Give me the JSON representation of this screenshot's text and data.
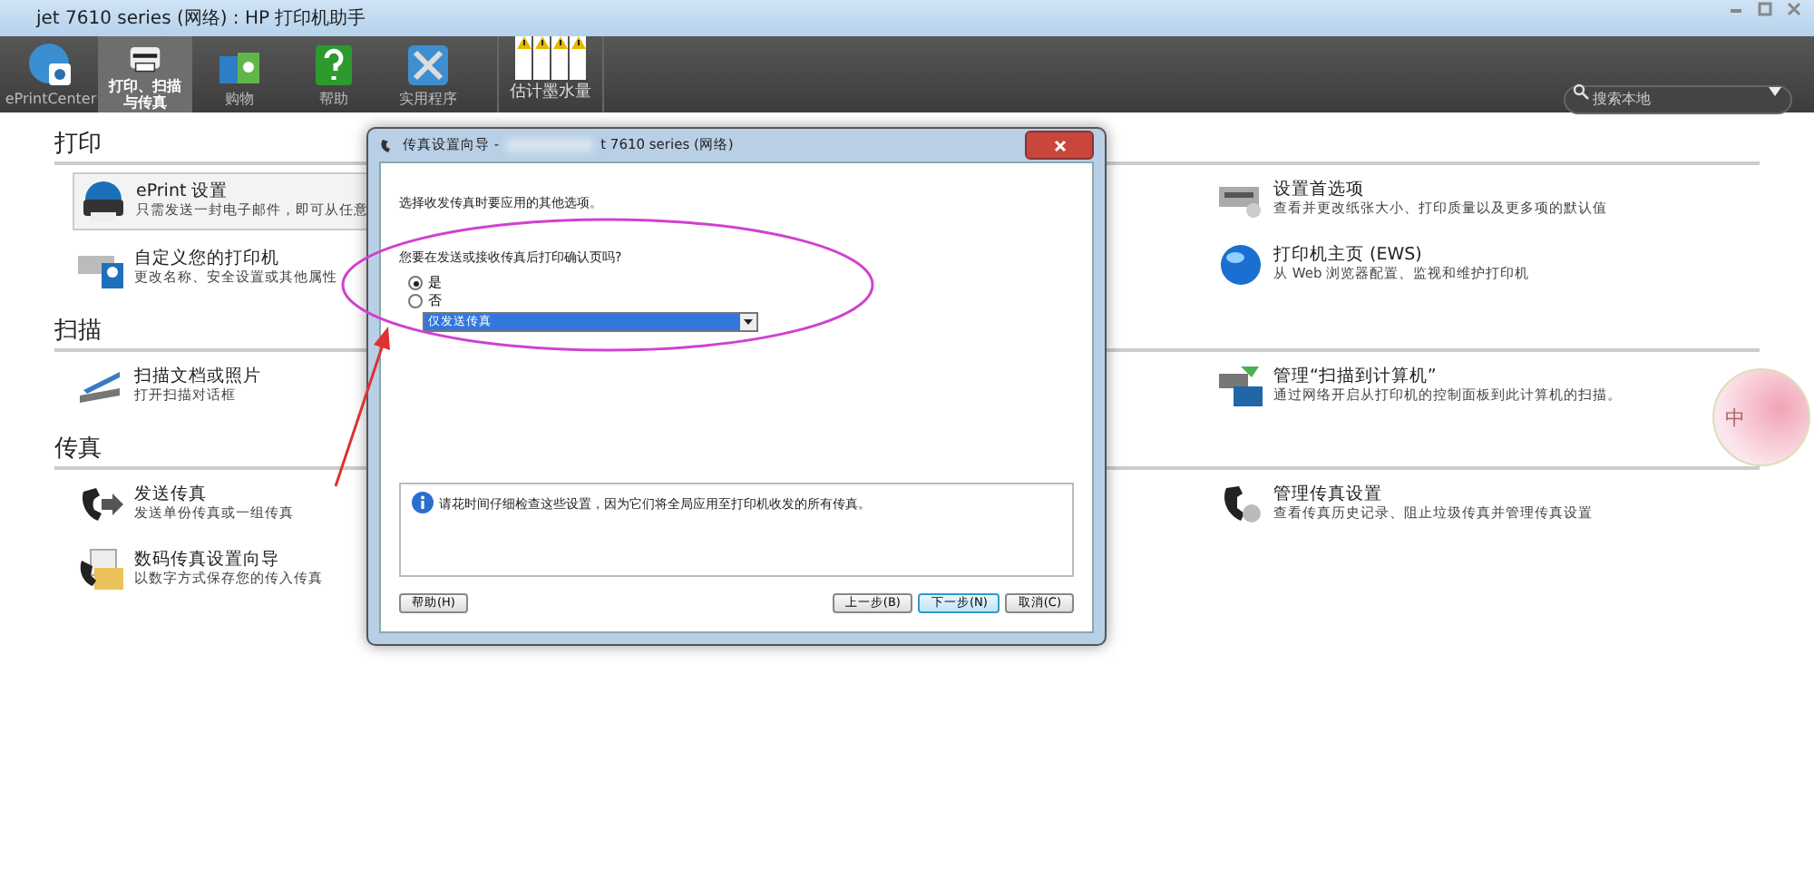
{
  "window": {
    "title": "jet 7610 series (网络) : HP 打印机助手"
  },
  "toolbar": [
    {
      "kind": "eprint",
      "label": "ePrintCenter",
      "selected": false
    },
    {
      "kind": "printer",
      "label": "打印、扫描与传真",
      "selected": true
    },
    {
      "kind": "shop",
      "label": "购物",
      "selected": false
    },
    {
      "kind": "help",
      "label": "帮助",
      "selected": false
    },
    {
      "kind": "tools",
      "label": "实用程序",
      "selected": false
    }
  ],
  "ink": {
    "label": "估计墨水量",
    "cartridges": [
      {
        "warning": true
      },
      {
        "warning": true
      },
      {
        "warning": true
      },
      {
        "warning": true
      }
    ]
  },
  "search": {
    "placeholder": "搜索本地"
  },
  "sections": [
    {
      "title": "打印",
      "left": [
        {
          "kind": "eprint",
          "title": "ePrint 设置",
          "desc": "只需发送一封电子邮件，即可从任意",
          "selected": true
        },
        {
          "kind": "printer",
          "title": "自定义您的打印机",
          "desc": "更改名称、安全设置或其他属性",
          "selected": false
        }
      ],
      "right": [
        {
          "kind": "prefs",
          "title": "设置首选项",
          "desc": "查看并更改纸张大小、打印质量以及更多项的默认值",
          "selected": false
        },
        {
          "kind": "globe",
          "title": "打印机主页 (EWS)",
          "desc": "从 Web 浏览器配置、监视和维护打印机",
          "selected": false
        }
      ]
    },
    {
      "title": "扫描",
      "left": [
        {
          "kind": "scanner",
          "title": "扫描文档或照片",
          "desc": "打开扫描对话框",
          "selected": false
        }
      ],
      "right": [
        {
          "kind": "computer",
          "title": "管理“扫描到计算机”",
          "desc": "通过网络开启从打印机的控制面板到此计算机的扫描。",
          "selected": false
        }
      ]
    },
    {
      "title": "传真",
      "left": [
        {
          "kind": "fax",
          "title": "发送传真",
          "desc": "发送单份传真或一组传真",
          "selected": false
        },
        {
          "kind": "folder",
          "title": "数码传真设置向导",
          "desc": "以数字方式保存您的传入传真",
          "selected": false
        }
      ],
      "right": [
        {
          "kind": "faxgear",
          "title": "管理传真设置",
          "desc": "查看传真历史记录、阻止垃圾传真并管理传真设置",
          "selected": false
        }
      ]
    }
  ],
  "dialog": {
    "title": "传真设置向导 -",
    "title_tail": "t 7610 series (网络)",
    "intro": "选择收发传真时要应用的其他选项。",
    "question": "您要在发送或接收传真后打印确认页吗?",
    "options": [
      {
        "label": "是",
        "selected": true
      },
      {
        "label": "否",
        "selected": false
      }
    ],
    "dropdown": {
      "value": "仅发送传真"
    },
    "info": "请花时间仔细检查这些设置，因为它们将全局应用至打印机收发的所有传真。",
    "help_button": "帮助(H)",
    "buttons": [
      {
        "label": "上一步(B)",
        "selected": false
      },
      {
        "label": "下一步(N)",
        "selected": true
      },
      {
        "label": "取消(C)",
        "selected": false
      }
    ]
  },
  "ime": {
    "label": "中"
  }
}
